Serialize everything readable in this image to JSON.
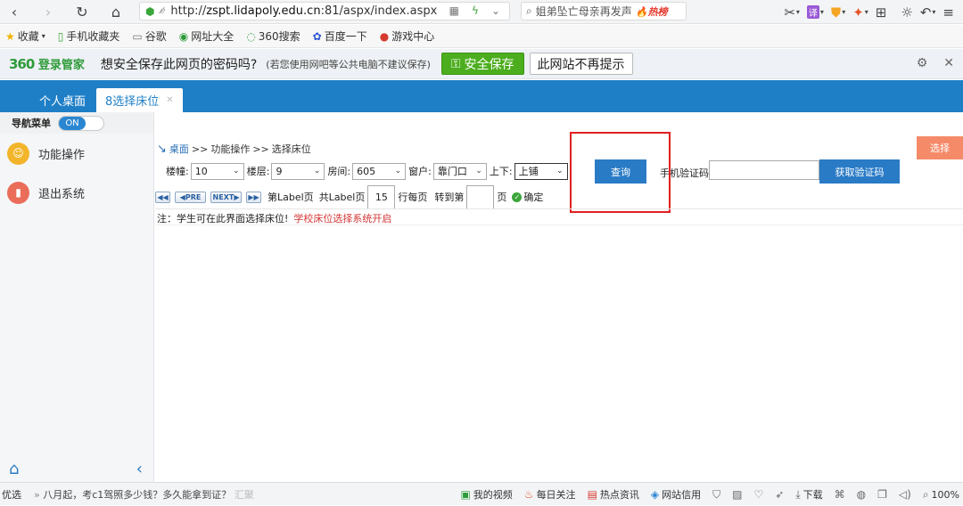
{
  "browser": {
    "url_prefix": "http://",
    "url_host": "zspt.lidapoly.edu.cn",
    "url_rest": ":81/aspx/index.aspx",
    "search_text": "姐弟坠亡母亲再发声",
    "search_badge": "热榜",
    "bookmarks": [
      {
        "label": "收藏",
        "icon": "star-icon"
      },
      {
        "label": "手机收藏夹",
        "icon": "phone-icon"
      },
      {
        "label": "谷歌",
        "icon": "page-icon"
      },
      {
        "label": "网址大全",
        "icon": "globe-icon"
      },
      {
        "label": "360搜索",
        "icon": "search-icon"
      },
      {
        "label": "百度一下",
        "icon": "paw-icon"
      },
      {
        "label": "游戏中心",
        "icon": "game-icon"
      }
    ],
    "password_bar": {
      "logo_brand": "360",
      "logo_text": "登录管家",
      "question": "想安全保存此网页的密码吗?",
      "note": "(若您使用网吧等公共电脑不建议保存)",
      "save_label": "安全保存",
      "no_label": "此网站不再提示"
    },
    "status": {
      "left_label": "优选",
      "news": "八月起，考c1驾照多少钱？多久能拿到证？",
      "news_faint": "汇聚",
      "items": [
        {
          "label": "我的视频",
          "icon": "video-icon"
        },
        {
          "label": "每日关注",
          "icon": "flame-icon"
        },
        {
          "label": "热点资讯",
          "icon": "news-icon"
        },
        {
          "label": "网站信用",
          "icon": "drop-icon"
        }
      ],
      "download_label": "下载",
      "zoom": "100%"
    }
  },
  "app": {
    "tabs": [
      {
        "label": "个人桌面"
      },
      {
        "label": "8选择床位"
      }
    ],
    "sidebar": {
      "nav_label": "导航菜单",
      "toggle_label": "ON",
      "items": [
        {
          "label": "功能操作",
          "icon": "people-icon"
        },
        {
          "label": "退出系统",
          "icon": "chart-icon"
        }
      ]
    },
    "breadcrumb": {
      "home": "桌面",
      "sep": ">>",
      "level1": "功能操作",
      "level2": "选择床位"
    },
    "select_button": "选择",
    "filters": {
      "building_label": "楼幢:",
      "building_value": "10",
      "floor_label": "楼层:",
      "floor_value": "9",
      "room_label": "房间:",
      "room_value": "605",
      "window_label": "窗户:",
      "window_value": "靠门口",
      "berth_label": "上下:",
      "berth_value": "上铺"
    },
    "query_button": "查询",
    "phone_label": "手机验证码:",
    "get_code_button": "获取验证码",
    "pager": {
      "first": "◀◀",
      "prev": "◀PRE",
      "next": "NEXT▶",
      "last": "▶▶",
      "page_text": "第Label页",
      "total_text": "共Label页",
      "per_page_value": "15",
      "per_page_text": "行每页",
      "goto_text": "转到第",
      "goto_value": "",
      "page_suffix": "页",
      "confirm": "确定"
    },
    "note_text": "注：学生可在此界面选择床位!",
    "note_red": "学校床位选择系统开启"
  }
}
